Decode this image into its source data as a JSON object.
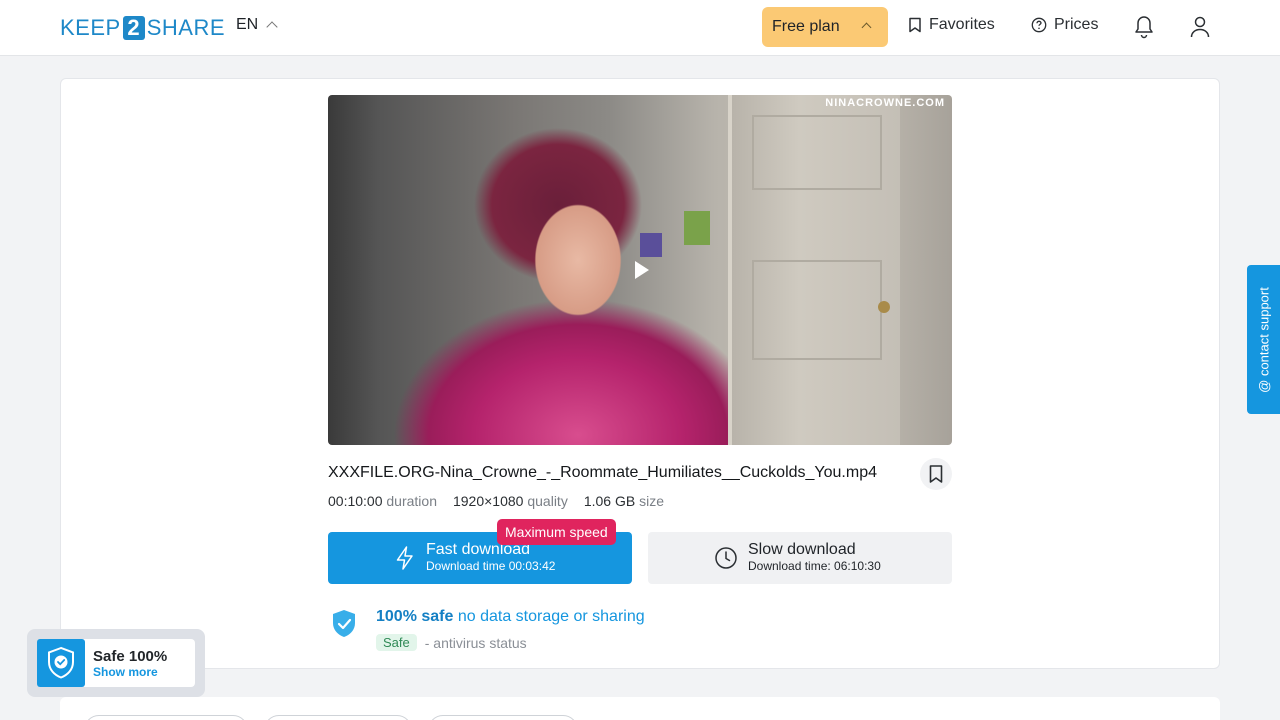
{
  "header": {
    "logo_left": "KEEP",
    "logo_mid": "2",
    "logo_right": "SHARE",
    "lang": "EN",
    "free_plan": "Free plan",
    "favorites": "Favorites",
    "prices": "Prices",
    "icons": [
      "bookmark-icon",
      "help-circle-icon",
      "bell-icon",
      "user-icon"
    ]
  },
  "video": {
    "watermark": "NINACROWNE.COM"
  },
  "file": {
    "name": "XXXFILE.ORG-Nina_Crowne_-_Roommate_Humiliates__Cuckolds_You.mp4",
    "duration": "00:10:00",
    "duration_label": "duration",
    "quality": "1920×1080",
    "quality_label": "quality",
    "size": "1.06 GB",
    "size_label": "size"
  },
  "download": {
    "max_speed_badge": "Maximum speed",
    "fast_title": "Fast download",
    "fast_sub": "Download time 00:03:42",
    "slow_title": "Slow download",
    "slow_sub": "Download time: 06:10:30"
  },
  "safety": {
    "strong": "100% safe",
    "rest": "no data storage or sharing",
    "badge": "Safe",
    "status": "- antivirus status"
  },
  "widget": {
    "title": "Safe 100%",
    "link": "Show more"
  },
  "support": {
    "label": "@ contact support"
  },
  "colors": {
    "accent": "#1596df",
    "free_plan_bg": "#fbc974",
    "max_speed": "#e0245e"
  }
}
